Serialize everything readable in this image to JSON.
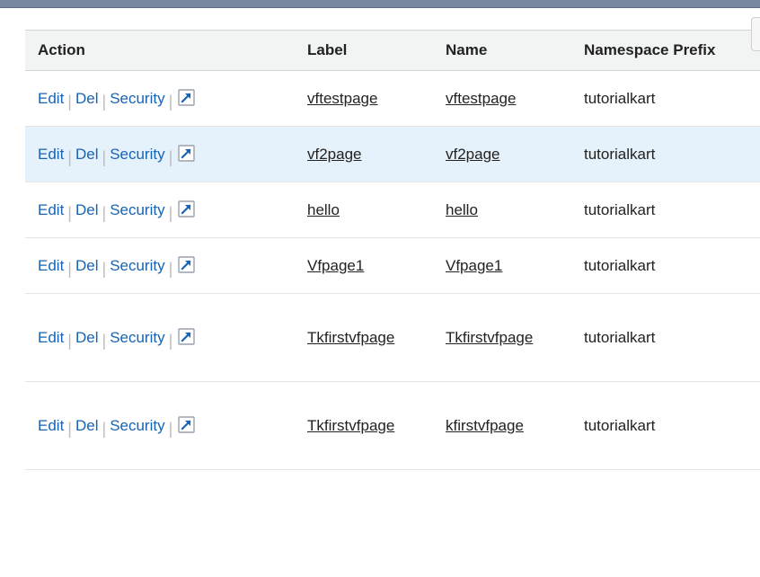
{
  "columns": {
    "action": "Action",
    "label": "Label",
    "name": "Name",
    "namespace": "Namespace Prefix"
  },
  "actions": {
    "edit": "Edit",
    "del": "Del",
    "security": "Security"
  },
  "rows": [
    {
      "label": "vftestpage",
      "name": "vftestpage",
      "namespace": "tutorialkart",
      "highlight": false,
      "tall": false
    },
    {
      "label": "vf2page",
      "name": "vf2page",
      "namespace": "tutorialkart",
      "highlight": true,
      "tall": false
    },
    {
      "label": "hello",
      "name": "hello",
      "namespace": "tutorialkart",
      "highlight": false,
      "tall": false
    },
    {
      "label": "Vfpage1",
      "name": "Vfpage1",
      "namespace": "tutorialkart",
      "highlight": false,
      "tall": false
    },
    {
      "label": "Tkfirstvfpage",
      "name": "Tkfirstvfpage",
      "namespace": "tutorialkart",
      "highlight": false,
      "tall": true
    },
    {
      "label": "Tkfirstvfpage",
      "name": "kfirstvfpage",
      "namespace": "tutorialkart",
      "highlight": false,
      "tall": true
    }
  ],
  "colors": {
    "link": "#1763b5",
    "headerBg": "#f2f3f3",
    "highlightBg": "#e6f2fb",
    "topbar": "#7787a0"
  }
}
